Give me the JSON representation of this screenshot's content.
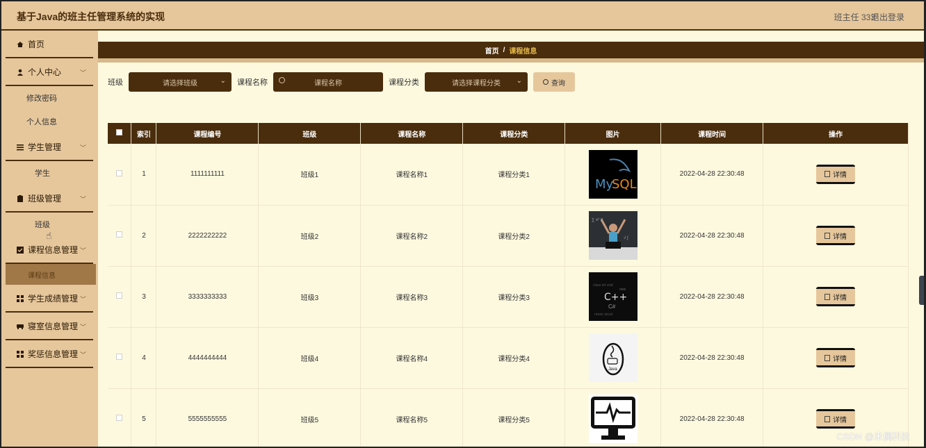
{
  "app": {
    "title": "基于Java的班主任管理系统的实现",
    "user": "班主任 333",
    "logout": "退出登录"
  },
  "sidebar": {
    "items": [
      {
        "label": "首页",
        "icon": "home-icon",
        "sub": []
      },
      {
        "label": "个人中心",
        "icon": "user-icon",
        "sub": [
          "修改密码",
          "个人信息"
        ]
      },
      {
        "label": "学生管理",
        "icon": "list-icon",
        "sub": [
          "学生"
        ]
      },
      {
        "label": "班级管理",
        "icon": "clipboard-icon",
        "sub": [
          "班级"
        ]
      },
      {
        "label": "课程信息管理",
        "icon": "checkbox-icon",
        "sub": [
          "课程信息"
        ]
      },
      {
        "label": "学生成绩管理",
        "icon": "grid-icon",
        "sub": []
      },
      {
        "label": "寝室信息管理",
        "icon": "bed-icon",
        "sub": []
      },
      {
        "label": "奖惩信息管理",
        "icon": "grid-icon",
        "sub": []
      }
    ]
  },
  "breadcrumb": {
    "home": "首页",
    "sep": "/",
    "current": "课程信息"
  },
  "search": {
    "class_label": "班级",
    "class_placeholder": "请选择班级",
    "name_label": "课程名称",
    "name_placeholder": "课程名称",
    "category_label": "课程分类",
    "category_placeholder": "请选择课程分类",
    "query_label": "查询"
  },
  "table": {
    "headers": [
      "索引",
      "课程编号",
      "班级",
      "课程名称",
      "课程分类",
      "图片",
      "课程时间",
      "操作"
    ],
    "rows": [
      {
        "index": "1",
        "code": "1111111111",
        "class": "班级1",
        "name": "课程名称1",
        "category": "课程分类1",
        "image": "mysql-logo",
        "time": "2022-04-28 22:30:48",
        "action": "详情"
      },
      {
        "index": "2",
        "code": "2222222222",
        "class": "班级2",
        "name": "课程名称2",
        "category": "课程分类2",
        "image": "student-laptop-photo",
        "time": "2022-04-28 22:30:48",
        "action": "详情"
      },
      {
        "index": "3",
        "code": "3333333333",
        "class": "班级3",
        "name": "课程名称3",
        "category": "课程分类3",
        "image": "cpp-wordcloud",
        "time": "2022-04-28 22:30:48",
        "action": "详情"
      },
      {
        "index": "4",
        "code": "4444444444",
        "class": "班级4",
        "name": "课程名称4",
        "category": "课程分类4",
        "image": "java-logo",
        "time": "2022-04-28 22:30:48",
        "action": "详情"
      },
      {
        "index": "5",
        "code": "5555555555",
        "class": "班级5",
        "name": "课程名称5",
        "category": "课程分类5",
        "image": "monitor-pulse-icon",
        "time": "2022-04-28 22:30:48",
        "action": "详情"
      }
    ]
  },
  "watermark": "CSDN @米偶科技",
  "colors": {
    "dark_brown": "#4a2d0d",
    "tan": "#e6c79c",
    "cream": "#fdf9df",
    "gold": "#e5b94a"
  }
}
